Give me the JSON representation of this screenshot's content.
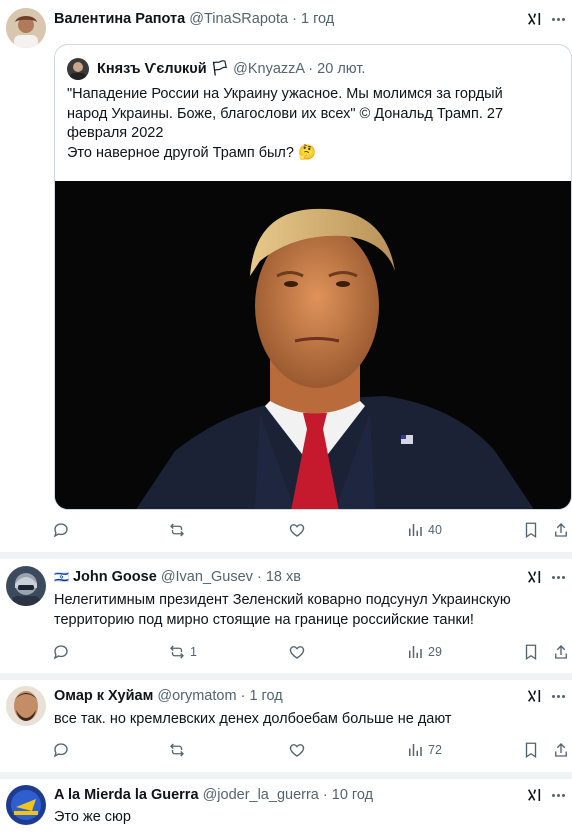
{
  "tweets": [
    {
      "author": "Валентина Рапота",
      "handle": "@TinaSRapota",
      "time": "1 год",
      "quote": {
        "author": "Князъ Ѵєлυкυй 🏳",
        "handle": "@KnyazzA",
        "time": "20 лют.",
        "text_line1": "\"Нападение России на Украину ужасное. Мы молимся за гордый",
        "text_line2": "народ Украины. Боже, благослови их всех\" © Дональд Трамп. 27",
        "text_line3": "февраля 2022",
        "text_line4": "Это наверное другой Трамп был? 🤔"
      },
      "views": "40",
      "replies": "",
      "retweets": ""
    },
    {
      "flag": "🇮🇱",
      "author": "John Goose",
      "handle": "@Ivan_Gusev",
      "time": "18 хв",
      "text_line1": "Нелегитимным президент Зеленский коварно подсунул Украинскую",
      "text_line2": "территорию под мирно стоящие на границе российские танки!",
      "replies": "",
      "retweets": "1",
      "views": "29"
    },
    {
      "author": "Омар к Хуйам",
      "handle": "@orymatom",
      "time": "1 год",
      "text_line1": "все так. но кремлевских денех долбоебам больше не дают",
      "retweets": "",
      "views": "72"
    },
    {
      "author": "A la Mierda la Guerra",
      "handle": "@joder_la_guerra",
      "time": "10 год",
      "text_line1": "Это же сюр"
    }
  ],
  "icons": {
    "reply": "reply-icon",
    "retweet": "retweet-icon",
    "like": "like-icon",
    "views": "views-icon",
    "bookmark": "bookmark-icon",
    "share": "share-icon",
    "grok": "grok-icon",
    "more": "more-icon"
  },
  "colors": {
    "text": "#0f1419",
    "muted": "#536471",
    "border": "#cfd9de",
    "divider": "#eff3f4"
  }
}
